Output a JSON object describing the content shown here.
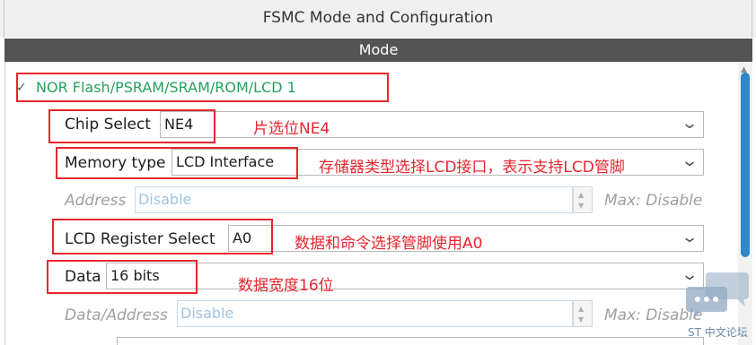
{
  "window": {
    "title": "FSMC Mode and Configuration"
  },
  "mode_header": "Mode",
  "tree": {
    "label": "NOR Flash/PSRAM/SRAM/ROM/LCD 1",
    "expanded": true
  },
  "fields": {
    "chip_select": {
      "label": "Chip Select",
      "value": "NE4"
    },
    "memory_type": {
      "label": "Memory type",
      "value": "LCD Interface"
    },
    "address": {
      "label": "Address",
      "value": "Disable",
      "max": "Max: Disable",
      "enabled": false
    },
    "lcd_register_select": {
      "label": "LCD Register Select",
      "value": "A0"
    },
    "data": {
      "label": "Data",
      "value": "16 bits"
    },
    "data_address": {
      "label": "Data/Address",
      "value": "Disable",
      "max": "Max: Disable",
      "enabled": false
    }
  },
  "annotations": {
    "chip_select": "片选位NE4",
    "memory_type": "存储器类型选择LCD接口，表示支持LCD管脚",
    "lcd_register_select": "数据和命令选择管脚使用A0",
    "data": "数据宽度16位"
  },
  "watermark": {
    "text": "ST 中文论坛"
  },
  "colors": {
    "annotation_red": "#e8262f",
    "tree_label_green": "#23a25d",
    "mode_header_bg": "#545454",
    "scroll_thumb": "#2f87c8",
    "disabled_text": "#9ec4e2"
  },
  "icons": {
    "chevron": "chevron-down-icon",
    "caret": "caret-down-icon",
    "spin_up": "spin-up-icon",
    "spin_down": "spin-down-icon",
    "watermark": "chat-bubbles-icon"
  }
}
